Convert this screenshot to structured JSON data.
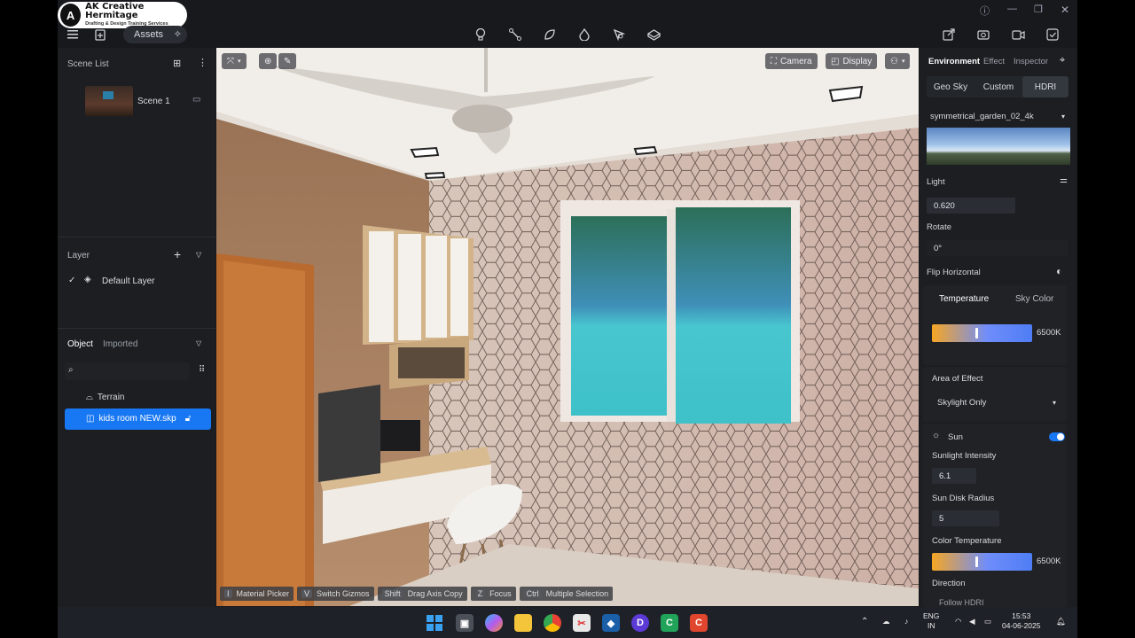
{
  "logo": {
    "mark": "A",
    "title": "AK Creative  Hermitage",
    "subtitle": "Drafting & Design Training Services"
  },
  "topbar": {
    "assets_label": "Assets",
    "tools": [
      "bulb-icon",
      "path-icon",
      "leaf-icon",
      "fire-icon",
      "pen-icon",
      "cube-icon"
    ],
    "right_tools": [
      "export-icon",
      "screenshot-icon",
      "video-icon",
      "render-icon"
    ],
    "window_controls": [
      "help-icon",
      "minimize-icon",
      "restore-icon",
      "close-icon"
    ]
  },
  "left": {
    "scene_list_title": "Scene List",
    "scene_name": "Scene 1",
    "layer_title": "Layer",
    "default_layer": "Default Layer",
    "object_tab": "Object",
    "imported_tab": "Imported",
    "tree": [
      "Terrain",
      "kids room NEW.skp"
    ]
  },
  "viewport": {
    "camera_label": "Camera",
    "display_label": "Display",
    "hints": [
      {
        "key": "I",
        "label": "Material Picker"
      },
      {
        "key": "V",
        "label": "Switch Gizmos"
      },
      {
        "key": "Shift",
        "label": "Drag Axis Copy"
      },
      {
        "key": "Z",
        "label": "Focus"
      },
      {
        "key": "Ctrl",
        "label": "Multiple Selection"
      }
    ]
  },
  "right": {
    "tabs": [
      "Environment",
      "Effect",
      "Inspector"
    ],
    "sky_modes": [
      "Geo Sky",
      "Custom",
      "HDRI"
    ],
    "hdri_name": "symmetrical_garden_02_4k",
    "light_label": "Light",
    "light_value": "0.620",
    "rotate_label": "Rotate",
    "rotate_value": "0°",
    "flip_label": "Flip Horizontal",
    "temp_tab": "Temperature",
    "skycolor_tab": "Sky Color",
    "temperature_value": "6500K",
    "area_label": "Area of Effect",
    "area_value": "Skylight Only",
    "sun_label": "Sun",
    "sun_intensity_label": "Sunlight Intensity",
    "sun_intensity_value": "6.1",
    "sun_disk_label": "Sun Disk Radius",
    "sun_disk_value": "5",
    "color_temp_label": "Color Temperature",
    "color_temp_value": "6500K",
    "direction_label": "Direction",
    "follow_label": "Follow HDRI"
  },
  "taskbar": {
    "lang_top": "ENG",
    "lang_bottom": "IN",
    "time": "15:53",
    "date": "04-06-2025"
  }
}
